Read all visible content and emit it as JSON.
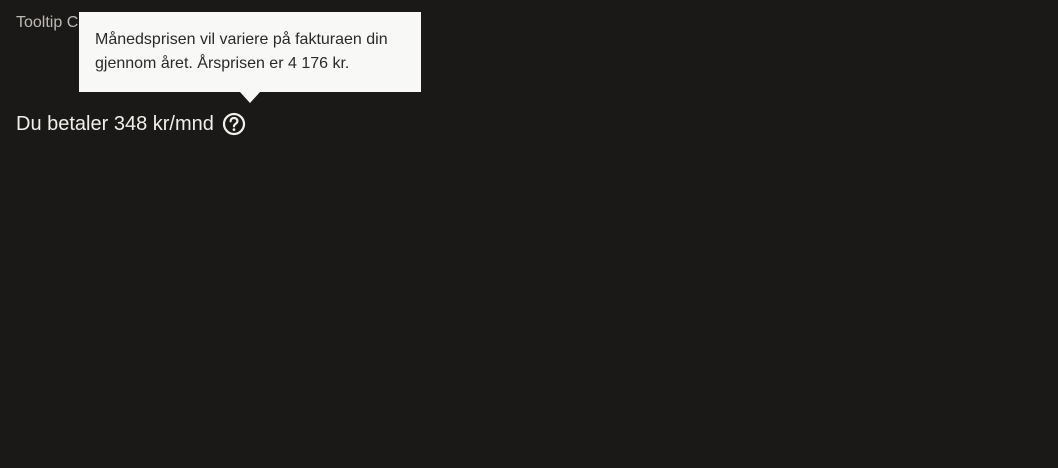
{
  "page": {
    "section_title": "Tooltip C",
    "price_text": "Du betaler 348 kr/mnd"
  },
  "tooltip": {
    "text": "Månedsprisen vil variere på fakturaen din gjennom året. Årsprisen er 4 176 kr."
  },
  "icons": {
    "help": "question-circle-icon"
  },
  "colors": {
    "background": "#1a1918",
    "text_primary": "#f2efeb",
    "text_muted": "#bdbab5",
    "tooltip_background": "#f8f8f7",
    "tooltip_text": "#2b2a28"
  }
}
